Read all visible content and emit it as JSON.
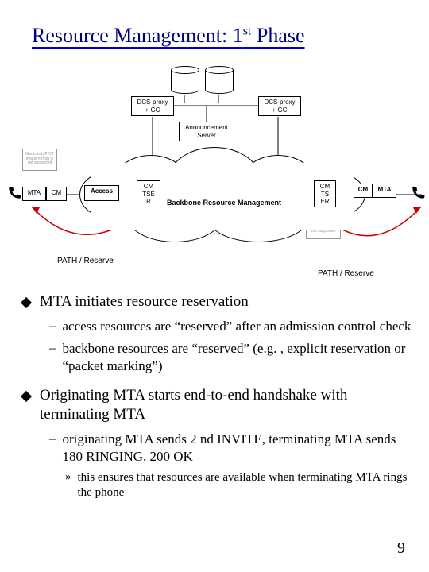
{
  "title_part1": "Resource Management: 1",
  "title_sup": "st",
  "title_part2": " Phase",
  "diagram": {
    "dcs_proxy_left": "DCS-proxy\n+ GC",
    "dcs_proxy_right": "DCS-proxy\n+ GC",
    "announcement_server": "Announcement\nServer",
    "mta_left": "MTA",
    "cm_left": "CM",
    "access_left": "Access",
    "cm_tse_r_left": "CM\nTSE\nR",
    "backbone": "Backbone Resource Management",
    "cm_ts_er_right": "CM\nTS\nER",
    "cm_right": "CM",
    "mta_right": "MTA",
    "path_reserve_left": "PATH / Reserve",
    "path_reserve_right": "PATH / Reserve",
    "pict_text": "Macintosh PICT\nimage format\nis not supported"
  },
  "bullets": {
    "b1": "MTA initiates resource reservation",
    "b1_sub1": "access resources are “reserved” after an admission control check",
    "b1_sub2": "backbone resources are “reserved” (e.g. , explicit reservation or “packet marking”)",
    "b2": "Originating MTA starts end-to-end handshake with terminating MTA",
    "b2_sub1": "originating MTA sends 2 nd INVITE, terminating MTA sends 180 RINGING, 200 OK",
    "b2_sub1_sub1": "this ensures that resources are available when terminating MTA rings the phone"
  },
  "page_number": "9"
}
